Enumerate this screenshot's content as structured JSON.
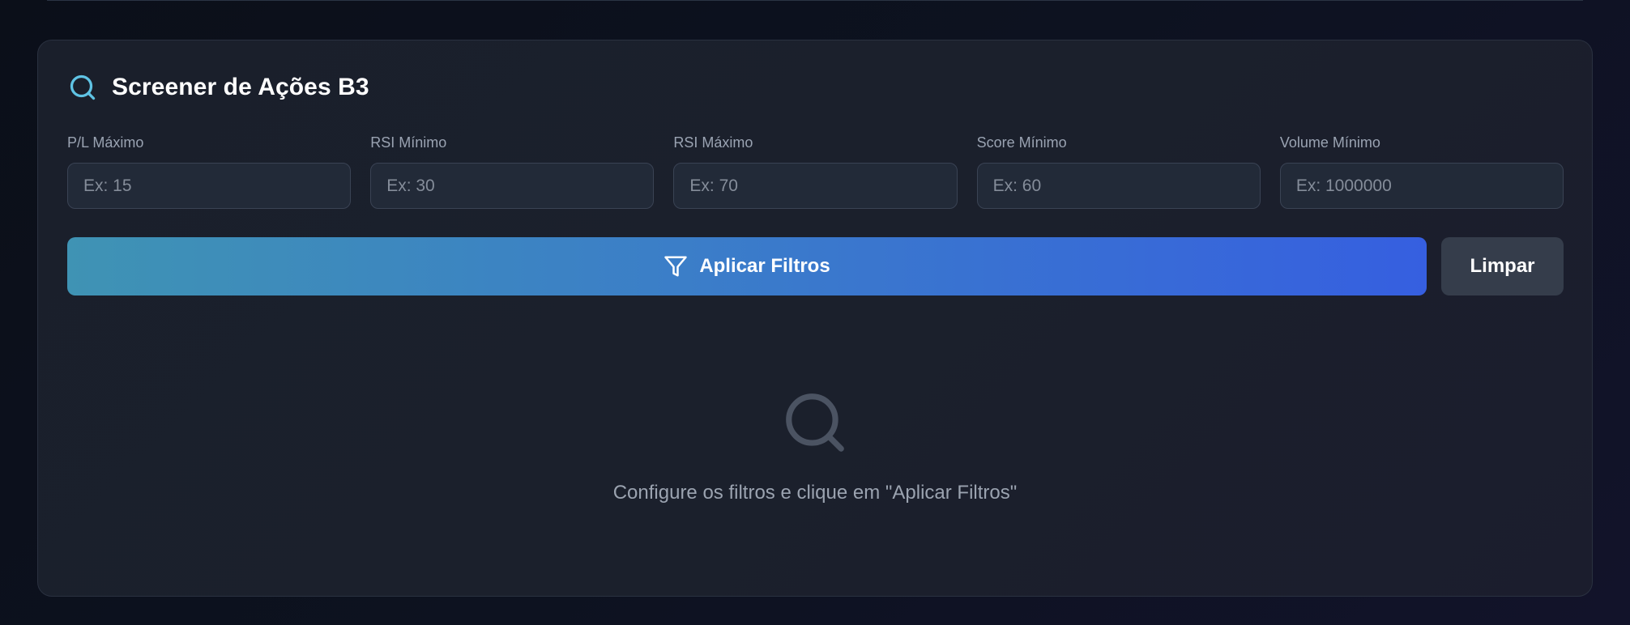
{
  "screener": {
    "title": "Screener de Ações B3",
    "title_icon": "search-icon",
    "filters": [
      {
        "label": "P/L Máximo",
        "placeholder": "Ex: 15",
        "value": ""
      },
      {
        "label": "RSI Mínimo",
        "placeholder": "Ex: 30",
        "value": ""
      },
      {
        "label": "RSI Máximo",
        "placeholder": "Ex: 70",
        "value": ""
      },
      {
        "label": "Score Mínimo",
        "placeholder": "Ex: 60",
        "value": ""
      },
      {
        "label": "Volume Mínimo",
        "placeholder": "Ex: 1000000",
        "value": ""
      }
    ],
    "apply_button": {
      "label": "Aplicar Filtros",
      "icon": "filter-icon"
    },
    "clear_button": {
      "label": "Limpar"
    },
    "empty_state": {
      "icon": "search-icon",
      "message": "Configure os filtros e clique em \"Aplicar Filtros\""
    }
  },
  "colors": {
    "accent_icon": "#5fc3e4",
    "button_gradient_start": "#3f93b4",
    "button_gradient_end": "#365fe0",
    "secondary_button": "#353d4b",
    "card_background": "#1b202c",
    "page_background": "#0d1220"
  }
}
